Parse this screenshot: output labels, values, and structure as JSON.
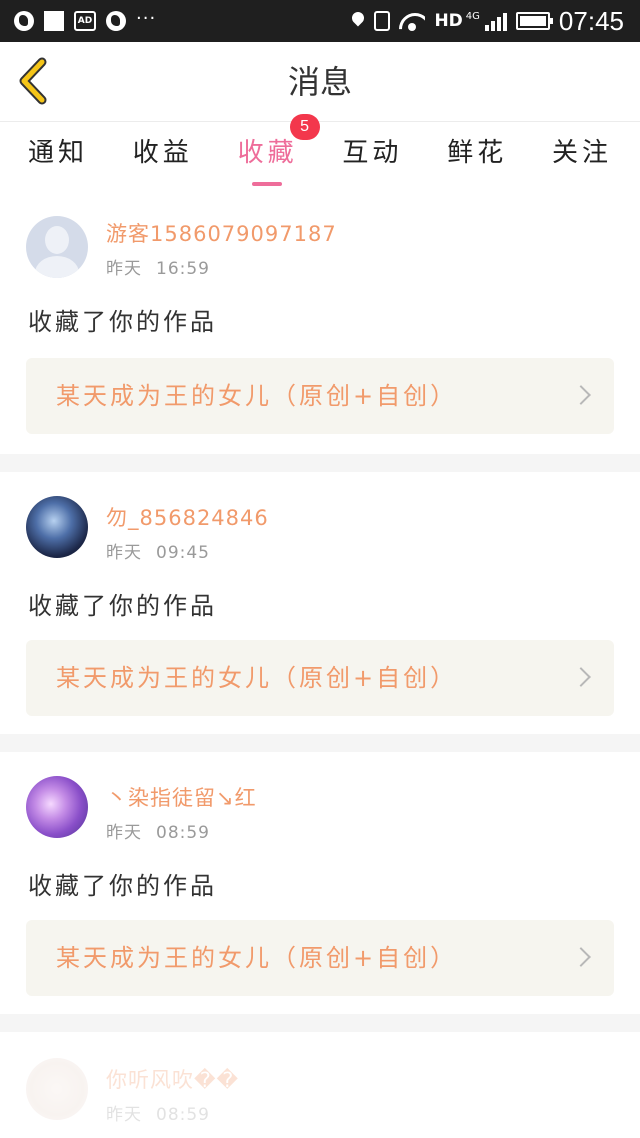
{
  "status_bar": {
    "network_label": "HD",
    "network_type": "4G",
    "time": "07:45",
    "ad_label": "AD",
    "dots": "···"
  },
  "header": {
    "title": "消息",
    "back_icon": "chevron-left-icon",
    "accent_color": "#f5c518"
  },
  "tabs": [
    {
      "label": "通知"
    },
    {
      "label": "收益"
    },
    {
      "label": "收藏",
      "active": true,
      "badge": "5"
    },
    {
      "label": "互动"
    },
    {
      "label": "鲜花"
    },
    {
      "label": "关注"
    }
  ],
  "colors": {
    "active_tab": "#ee6d9a",
    "badge": "#f3374c",
    "username": "#f19a6b",
    "work_title": "#f19a6b"
  },
  "messages": [
    {
      "username": "游客1586079097187",
      "day": "昨天",
      "time": "16:59",
      "action": "收藏了你的作品",
      "work": "某天成为王的女儿（原创+自创）",
      "avatar": "default-user-avatar"
    },
    {
      "username": "勿_856824846",
      "day": "昨天",
      "time": "09:45",
      "action": "收藏了你的作品",
      "work": "某天成为王的女儿（原创+自创）",
      "avatar": "anime-avatar-blue"
    },
    {
      "username": "丶染指徒留↘红",
      "day": "昨天",
      "time": "08:59",
      "action": "收藏了你的作品",
      "work": "某天成为王的女儿（原创+自创）",
      "avatar": "anime-avatar-purple"
    },
    {
      "username": "你听风吹��",
      "day": "昨天",
      "time": "08:59",
      "avatar": "anime-avatar-faded"
    }
  ]
}
